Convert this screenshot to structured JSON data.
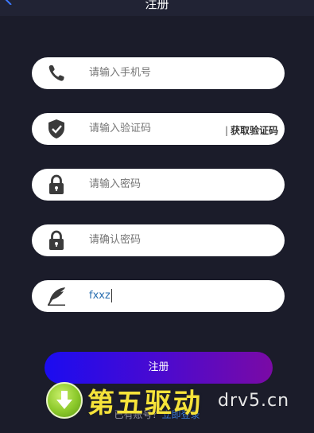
{
  "header": {
    "title": "注册"
  },
  "form": {
    "phone_placeholder": "请输入手机号",
    "code_placeholder": "请输入验证码",
    "get_code_label": "获取验证码",
    "password_placeholder": "请输入密码",
    "confirm_password_placeholder": "请确认密码",
    "nickname_value": "fxxz"
  },
  "register_label": "注册",
  "footer": {
    "have_account": "已有账号？",
    "login_link": "立即登录"
  },
  "watermark": {
    "brand": "第五驱动",
    "domain": "drv5.cn"
  },
  "colors": {
    "background": "#1b1c2a",
    "button_gradient_start": "#1b0cf0",
    "button_gradient_end": "#7a0aa5",
    "icon_dark": "#3b3b3b"
  },
  "icons": {
    "back": "chevron-left-icon",
    "phone": "phone-icon",
    "code": "shield-check-icon",
    "password": "lock-icon",
    "confirm": "lock-icon",
    "nickname": "feather-icon"
  }
}
